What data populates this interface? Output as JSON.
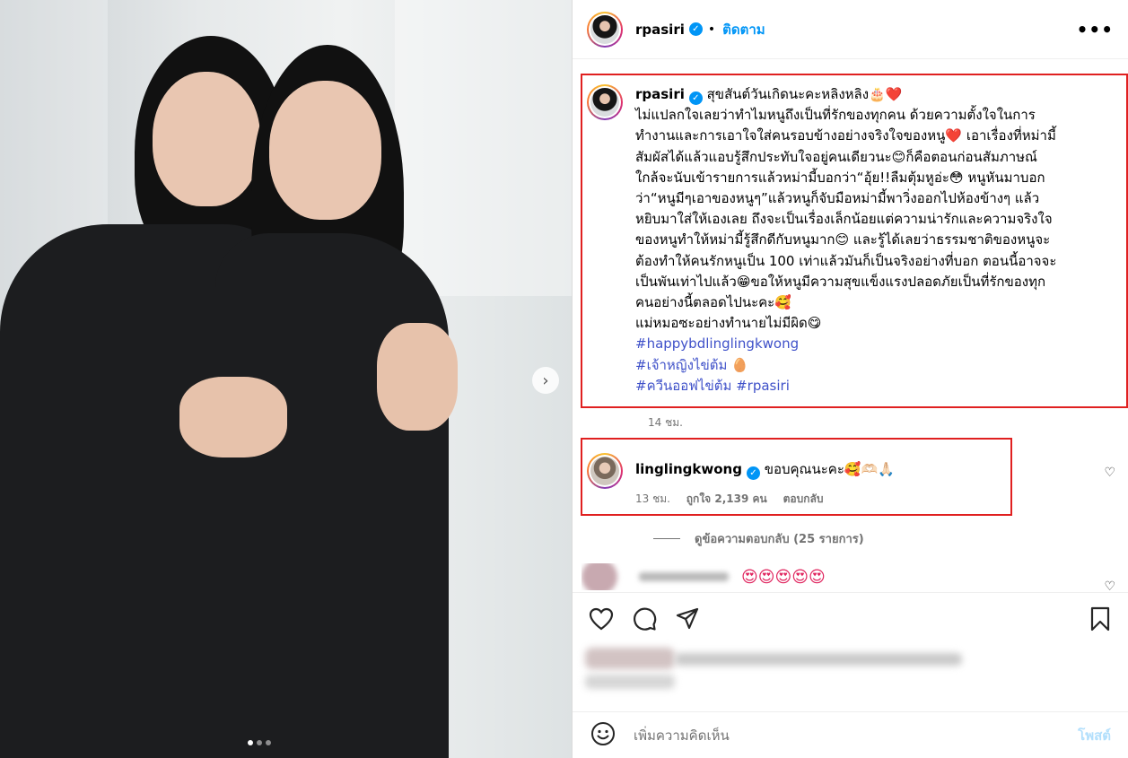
{
  "post": {
    "username": "rpasiri",
    "follow_label": "ติดตาม",
    "bullet": "•",
    "more_label": "•••",
    "carousel": {
      "current": 1,
      "total": 3
    }
  },
  "caption": {
    "username": "rpasiri",
    "lines": [
      "สุขสันต์วันเกิดนะคะหลิงหลิง🎂❤️",
      "ไม่แปลกใจเลยว่าทำไมหนูถึงเป็นที่รักของทุกคน ด้วยความตั้งใจในการ",
      "ทำงานและการเอาใจใส่คนรอบข้างอย่างจริงใจของหนู❤️ เอาเรื่องที่หม่ามี้",
      "สัมผัสได้แล้วแอบรู้สึกประทับใจอยู่คนเดียวนะ😊ก็คือตอนก่อนสัมภาษณ์",
      "ใกล้จะนับเข้ารายการแล้วหม่ามี้บอกว่า“อุ้ย!!ลืมตุ้มหูอ่ะ😳 หนูหันมาบอก",
      "ว่า“หนูมีๆเอาของหนูๆ”แล้วหนูก็จับมือหม่ามี้พาวิ่งออกไปห้องข้างๆ แล้ว",
      "หยิบมาใส่ให้เองเลย ถึงจะเป็นเรื่องเล็กน้อยแต่ความน่ารักและความจริงใจ",
      "ของหนูทำให้หม่ามี้รู้สึกดีกับหนูมาก😊 และรู้ได้เลยว่าธรรมชาติของหนูจะ",
      "ต้องทำให้คนรักหนูเป็น 100 เท่าแล้วมันก็เป็นจริงอย่างที่บอก ตอนนี้อาจจะ",
      "เป็นพันเท่าไปแล้ว😁ขอให้หนูมีความสุขแข็งแรงปลอดภัยเป็นที่รักของทุก",
      "คนอย่างนี้ตลอดไปนะคะ🥰",
      "แม่หมอซะอย่างทำนายไม่มีผิด😋"
    ],
    "hashtags": [
      "#happybdlinglingkwong",
      "#เจ้าหญิงไข่ต้ม 🥚",
      "#ควีนออฟไข่ต้ม #rpasiri"
    ],
    "time": "14 ชม."
  },
  "comment": {
    "username": "linglingkwong",
    "text": "ขอบคุณนะคะ🥰🫶🏻🙏🏻",
    "time": "13 ชม.",
    "likes": "ถูกใจ 2,139 คน",
    "reply": "ตอบกลับ",
    "view_replies": "ดูข้อความตอบกลับ (25 รายการ)"
  },
  "comment2": {
    "emojis": "😍😍😍😍😍"
  },
  "add_comment": {
    "placeholder": "เพิ่มความคิดเห็น",
    "post_label": "โพสต์"
  },
  "icons": {
    "heart": "heart-icon",
    "comment": "comment-icon",
    "share": "share-icon",
    "bookmark": "bookmark-icon",
    "emoji": "emoji-icon",
    "next": "chevron-right-icon"
  },
  "colors": {
    "accent": "#0095f6",
    "highlight_border": "#e02020",
    "hashtag": "#3f51c9"
  }
}
